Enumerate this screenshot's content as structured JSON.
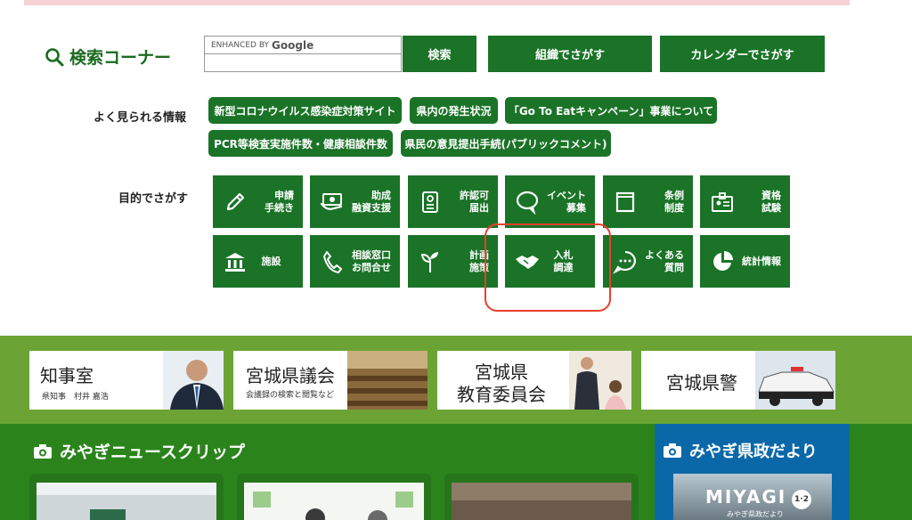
{
  "search": {
    "title": "検索コーナー",
    "enhanced_by": "ENHANCED BY",
    "google": "Google",
    "search_button": "検索",
    "org_button": "組織でさがす",
    "calendar_button": "カレンダーでさがす"
  },
  "popular": {
    "label": "よく見られる情報",
    "links": [
      "新型コロナウイルス感染症対策サイト",
      "県内の発生状況",
      "「Go To Eatキャンペーン」事業について",
      "PCR等検査実施件数・健康相談件数",
      "県民の意見提出手続(パブリックコメント)"
    ]
  },
  "purpose": {
    "label": "目的でさがす",
    "tiles": [
      {
        "label": "申請\n手続き",
        "icon": "pencil-icon"
      },
      {
        "label": "助成\n融資支援",
        "icon": "money-icon"
      },
      {
        "label": "許認可\n届出",
        "icon": "certificate-icon"
      },
      {
        "label": "イベント\n募集",
        "icon": "speech-bubble-icon"
      },
      {
        "label": "条例\n制度",
        "icon": "book-icon"
      },
      {
        "label": "資格\n試験",
        "icon": "id-badge-icon"
      },
      {
        "label": "施設",
        "icon": "building-icon"
      },
      {
        "label": "相談窓口\nお問合せ",
        "icon": "phone-icon"
      },
      {
        "label": "計画\n施策",
        "icon": "sprout-icon"
      },
      {
        "label": "入札\n調達",
        "icon": "handshake-icon"
      },
      {
        "label": "よくある\n質問",
        "icon": "question-bubble-icon"
      },
      {
        "label": "統計情報",
        "icon": "pie-chart-icon"
      }
    ]
  },
  "banners": {
    "governor_title": "知事室",
    "governor_sub": "県知事　村井 嘉浩",
    "assembly_title": "宮城県議会",
    "assembly_sub": "会議録の検索と閲覧など",
    "education_line1": "宮城県",
    "education_line2": "教育委員会",
    "police_title": "宮城県警"
  },
  "news": {
    "title": "みやぎニュースクリップ"
  },
  "dayori": {
    "title": "みやぎ県政だより",
    "miyagi": "MIYAGI",
    "issue": "1·2",
    "sub": "みやぎ県政だより"
  },
  "colors": {
    "primary_green": "#1a7327",
    "band_light": "#6ba434",
    "band_dark": "#2a841b",
    "dayori_blue": "#0b68a8",
    "highlight": "#e8402a"
  }
}
